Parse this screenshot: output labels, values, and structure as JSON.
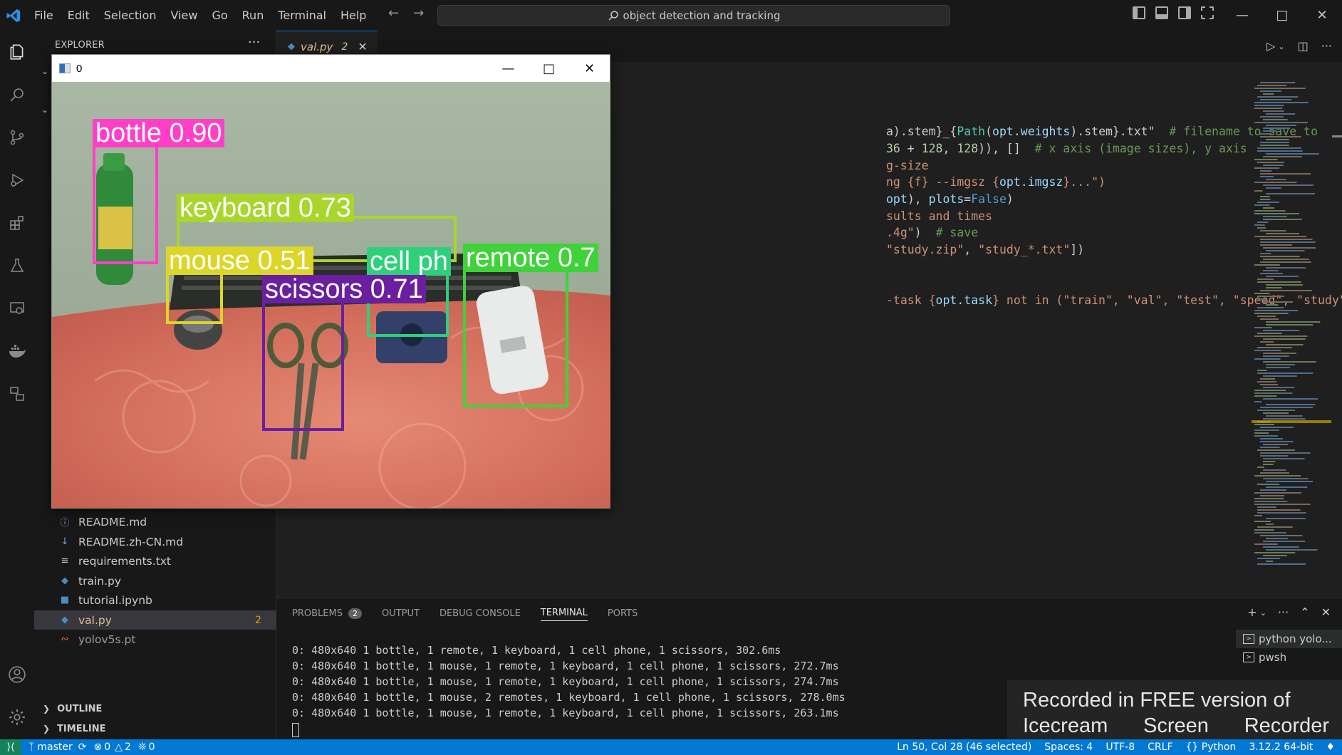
{
  "titlebar": {
    "menu": [
      "File",
      "Edit",
      "Selection",
      "View",
      "Go",
      "Run",
      "Terminal",
      "Help"
    ],
    "search_text": "object detection and tracking"
  },
  "sidebar": {
    "title": "EXPLORER",
    "files": [
      {
        "name": "README.md",
        "icon": "info-icon"
      },
      {
        "name": "README.zh-CN.md",
        "icon": "markdown-icon"
      },
      {
        "name": "requirements.txt",
        "icon": "text-file-icon"
      },
      {
        "name": "train.py",
        "icon": "python-icon"
      },
      {
        "name": "tutorial.ipynb",
        "icon": "notebook-icon"
      },
      {
        "name": "val.py",
        "icon": "python-icon",
        "badge": "2",
        "active": true
      },
      {
        "name": "yolov5s.pt",
        "icon": "rss-icon"
      }
    ],
    "outline_label": "OUTLINE",
    "timeline_label": "TIMELINE"
  },
  "tabs": {
    "active_name": "val.py",
    "active_count": "2"
  },
  "camera_window": {
    "title": "0",
    "detections": [
      {
        "label": "bottle 0.90",
        "color": "#ff3fc8"
      },
      {
        "label": "keyboard 0.73",
        "color": "#a8d62c"
      },
      {
        "label": "mouse 0.51",
        "color": "#dcd52a"
      },
      {
        "label": "cell ph",
        "color": "#2ed07a"
      },
      {
        "label": "remote 0.7",
        "color": "#3fd23a"
      },
      {
        "label": "scissors 0.71",
        "color": "#6a1fa0"
      }
    ]
  },
  "editor": {
    "lines": [
      {
        "segments": [
          [
            "",
            "a).stem}_{"
          ],
          [
            "k-g",
            "Path"
          ],
          [
            "",
            "("
          ],
          [
            "k-v",
            "opt"
          ],
          [
            "",
            "."
          ],
          [
            "k-v",
            "weights"
          ],
          [
            "",
            ").stem}.txt\""
          ],
          [
            "",
            "  "
          ],
          [
            "k-c",
            "# filename to save to"
          ]
        ]
      },
      {
        "segments": [
          [
            "k-n",
            "36"
          ],
          [
            "",
            " + "
          ],
          [
            "k-n",
            "128"
          ],
          [
            "",
            ", "
          ],
          [
            "k-n",
            "128"
          ],
          [
            "",
            ")), []  "
          ],
          [
            "k-c",
            "# x axis (image sizes), y axis"
          ]
        ]
      },
      {
        "segments": [
          [
            "k-s",
            "g-size"
          ]
        ]
      },
      {
        "segments": [
          [
            "k-s",
            "ng {f} --imgsz {"
          ],
          [
            "k-v",
            "opt.imgsz"
          ],
          [
            "k-s",
            "}...\")"
          ]
        ]
      },
      {
        "segments": [
          [
            "k-v",
            "opt"
          ],
          [
            "",
            "), "
          ],
          [
            "k-v",
            "plots"
          ],
          [
            "",
            "="
          ],
          [
            "k-b",
            "False"
          ],
          [
            "",
            ")"
          ]
        ]
      },
      {
        "segments": [
          [
            "k-s",
            "sults and times"
          ]
        ]
      },
      {
        "segments": [
          [
            "k-s",
            ".4g\""
          ],
          [
            "",
            ")  "
          ],
          [
            "k-c",
            "# save"
          ]
        ]
      },
      {
        "segments": [
          [
            "k-s",
            "\"study.zip\""
          ],
          [
            "",
            ", "
          ],
          [
            "k-s",
            "\"study_*.txt\""
          ],
          [
            "",
            "])"
          ]
        ]
      },
      {
        "segments": [
          [
            "",
            ""
          ]
        ]
      },
      {
        "segments": [
          [
            "",
            ""
          ]
        ]
      },
      {
        "segments": [
          [
            "k-s",
            "-task {"
          ],
          [
            "k-v",
            "opt.task"
          ],
          [
            "k-s",
            "} not in (\"train\", \"val\", \"test\", \"speed\", \"study\")')"
          ]
        ]
      }
    ]
  },
  "panel": {
    "tabs": [
      "PROBLEMS",
      "OUTPUT",
      "DEBUG CONSOLE",
      "TERMINAL",
      "PORTS"
    ],
    "problems_count": "2",
    "active_tab": "TERMINAL",
    "terminal_lines": [
      "0: 480x640 1 bottle, 1 remote, 1 keyboard, 1 cell phone, 1 scissors, 302.6ms",
      "0: 480x640 1 bottle, 1 mouse, 1 remote, 1 keyboard, 1 cell phone, 1 scissors, 272.7ms",
      "0: 480x640 1 bottle, 1 mouse, 1 remote, 1 keyboard, 1 cell phone, 1 scissors, 274.7ms",
      "0: 480x640 1 bottle, 1 mouse, 2 remotes, 1 keyboard, 1 cell phone, 1 scissors, 278.0ms",
      "0: 480x640 1 bottle, 1 mouse, 1 remote, 1 keyboard, 1 cell phone, 1 scissors, 263.1ms"
    ],
    "terminal_list": [
      "python yolo...",
      "pwsh"
    ]
  },
  "watermark": {
    "line1": "Recorded in FREE version of",
    "line2": [
      "Icecream",
      "Screen",
      "Recorder"
    ]
  },
  "statusbar": {
    "branch": "master",
    "errors": "0",
    "warnings": "2",
    "ports": "0",
    "cursor_pos": "Ln 50, Col 28 (46 selected)",
    "spaces": "Spaces: 4",
    "encoding": "UTF-8",
    "eol": "CRLF",
    "language": "Python",
    "interpreter": "3.12.2 64-bit"
  },
  "colors": {
    "accent": "#0078d4",
    "statusbar": "#0078d4",
    "warning": "#cca700"
  }
}
